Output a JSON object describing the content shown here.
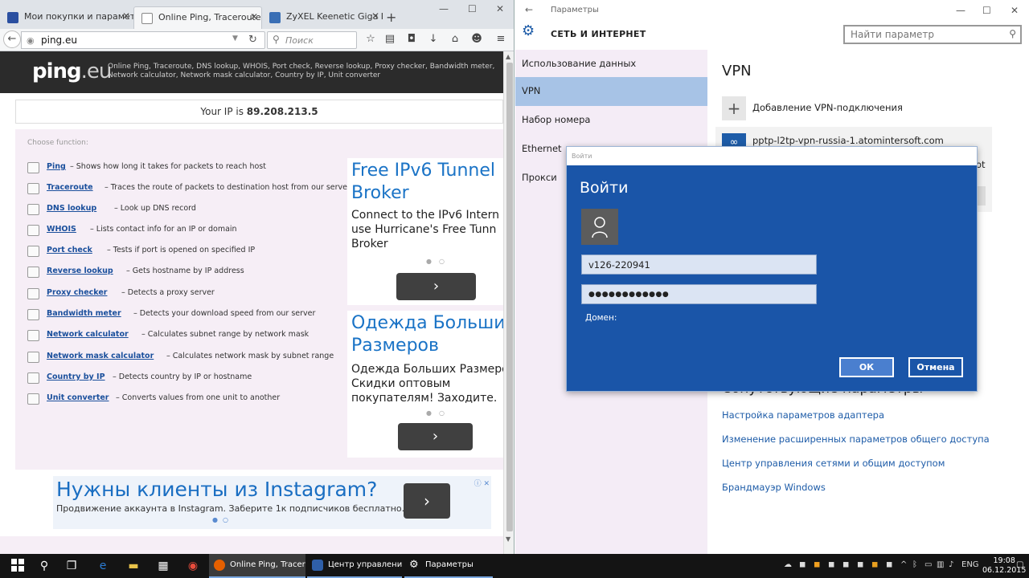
{
  "firefox": {
    "tabs": [
      {
        "label": "Мои покупки и параметр..."
      },
      {
        "label": "Online Ping, Traceroute, ..."
      },
      {
        "label": "ZyXEL Keenetic Giga II По..."
      }
    ],
    "url": "ping.eu",
    "search_placeholder": "Поиск"
  },
  "pingeu": {
    "logo_main": "ping",
    "logo_tld": ".eu",
    "description": "Online Ping, Traceroute, DNS lookup, WHOIS, Port check, Reverse lookup, Proxy checker, Bandwidth meter, Network calculator, Network mask calculator, Country by IP, Unit converter",
    "ip_prefix": "Your IP is",
    "ip_value": "89.208.213.5",
    "choose_label": "Choose function:",
    "functions": [
      {
        "name": "Ping",
        "desc": "– Shows how long it takes for packets to reach host"
      },
      {
        "name": "Traceroute",
        "desc": "– Traces the route of packets to destination host from our server"
      },
      {
        "name": "DNS lookup",
        "desc": "– Look up DNS record"
      },
      {
        "name": "WHOIS",
        "desc": "– Lists contact info for an IP or domain"
      },
      {
        "name": "Port check",
        "desc": "– Tests if port is opened on specified IP"
      },
      {
        "name": "Reverse lookup",
        "desc": "– Gets hostname by IP address"
      },
      {
        "name": "Proxy checker",
        "desc": "– Detects a proxy server"
      },
      {
        "name": "Bandwidth meter",
        "desc": "– Detects your download speed from our server"
      },
      {
        "name": "Network calculator",
        "desc": "– Calculates subnet range by network mask"
      },
      {
        "name": "Network mask calculator",
        "desc": "– Calculates network mask by subnet range"
      },
      {
        "name": "Country by IP",
        "desc": "– Detects country by IP or hostname"
      },
      {
        "name": "Unit converter",
        "desc": "– Converts values from one unit to another"
      }
    ],
    "ad1": {
      "title_line1": "Free IPv6 Tunnel",
      "title_line2": "Broker",
      "text_line1": "Connect to the IPv6 Intern",
      "text_line2": "use Hurricane's Free Tunn",
      "text_line3": "Broker",
      "arrow": "›"
    },
    "ad2": {
      "title_line1": "Одежда Больших",
      "title_line2": "Размеров",
      "text_line1": "Одежда Больших Размеро",
      "text_line2": "Скидки оптовым",
      "text_line3": "покупателям! Заходите.",
      "arrow": "›"
    },
    "banner": {
      "title": "Нужны клиенты из Instagram?",
      "subtitle": "Продвижение аккаунта в Instagram. Заберите 1к подписчиков бесплатно.",
      "arrow": "›",
      "info": "ⓘ ✕",
      "dots": "●○"
    }
  },
  "settings": {
    "window_title": "Параметры",
    "header": "СЕТЬ И ИНТЕРНЕТ",
    "search_placeholder": "Найти параметр",
    "nav": [
      {
        "label": "Использование данных"
      },
      {
        "label": "VPN"
      },
      {
        "label": "Набор номера"
      },
      {
        "label": "Ethernet"
      },
      {
        "label": "Прокси"
      }
    ],
    "page_title": "VPN",
    "add_vpn": "Добавление VPN-подключения",
    "connection_name": "pptp-l2tp-vpn-russia-1.atomintersoft.com",
    "connection_cut": "ot",
    "related_title": "Сопутствующие параметры",
    "related_links": [
      {
        "label": "Настройка параметров адаптера"
      },
      {
        "label": "Изменение расширенных параметров общего доступа"
      },
      {
        "label": "Центр управления сетями и общим доступом"
      },
      {
        "label": "Брандмауэр Windows"
      }
    ]
  },
  "login_dialog": {
    "window_title": "Войти",
    "heading": "Войти",
    "username": "v126-220941",
    "password_mask": "●●●●●●●●●●●●",
    "domain_label": "Домен:",
    "ok_label": "ОК",
    "cancel_label": "Отмена"
  },
  "taskbar": {
    "apps": [
      {
        "label": "Online Ping, Tracero..."
      },
      {
        "label": "Центр управления ..."
      },
      {
        "label": "Параметры"
      }
    ],
    "language": "ENG",
    "time": "19:08",
    "date": "06.12.2015"
  }
}
